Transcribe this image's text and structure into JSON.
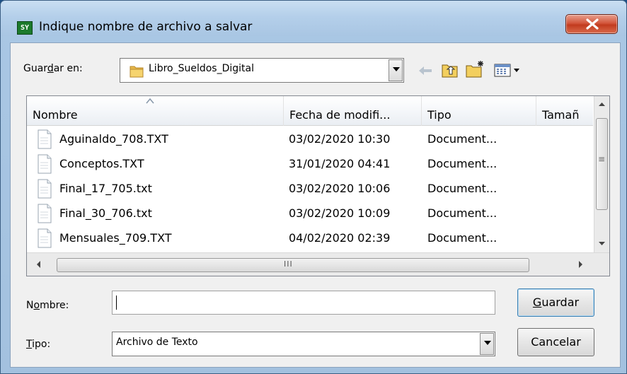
{
  "window": {
    "title": "Indique nombre de archivo a salvar",
    "app_icon_text": "SY"
  },
  "toolbar": {
    "save_in_label_pre": "Guar",
    "save_in_label_key": "d",
    "save_in_label_post": "ar en:",
    "folder": "Libro_Sueldos_Digital",
    "icons": [
      "back-arrow-icon",
      "up-folder-icon",
      "new-folder-icon",
      "view-menu-icon"
    ]
  },
  "list": {
    "columns": [
      "Nombre",
      "Fecha de modifi...",
      "Tipo",
      "Tamañ"
    ],
    "rows": [
      {
        "name": "Aguinaldo_708.TXT",
        "date": "03/02/2020 10:30",
        "type": "Document..."
      },
      {
        "name": "Conceptos.TXT",
        "date": "31/01/2020 04:41",
        "type": "Document..."
      },
      {
        "name": "Final_17_705.txt",
        "date": "03/02/2020 10:06",
        "type": "Document..."
      },
      {
        "name": "Final_30_706.txt",
        "date": "03/02/2020 10:09",
        "type": "Document..."
      },
      {
        "name": "Mensuales_709.TXT",
        "date": "04/02/2020 02:39",
        "type": "Document..."
      }
    ],
    "hscroll_grip": "III",
    "vscroll_grip": "≡"
  },
  "form": {
    "name_label_pre": "N",
    "name_label_key": "o",
    "name_label_post": "mbre:",
    "name_value": "",
    "type_label_key": "T",
    "type_label_post": "ipo:",
    "type_value": "Archivo de Texto"
  },
  "buttons": {
    "save_key": "G",
    "save_post": "uardar",
    "cancel": "Cancelar"
  },
  "colors": {
    "titlebar": "#b4cfea",
    "close_button": "#c94a2d",
    "dialog_bg": "#f0f0f0"
  }
}
